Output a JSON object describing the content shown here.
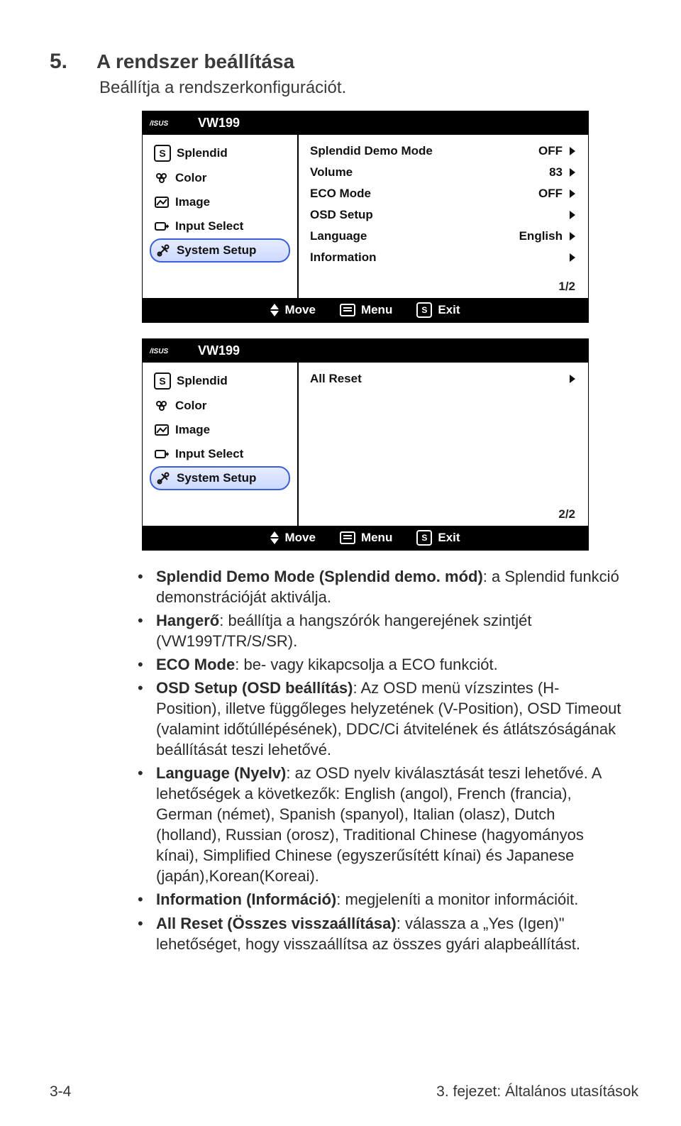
{
  "heading": {
    "number": "5.",
    "title": "A rendszer beállítása",
    "subtitle": "Beállítja a rendszerkonfigurációt."
  },
  "osd_top": {
    "model": "VW199",
    "menu_left": [
      {
        "icon": "S-box",
        "label": "Splendid",
        "selected": false
      },
      {
        "icon": "palette",
        "label": "Color",
        "selected": false
      },
      {
        "icon": "image",
        "label": "Image",
        "selected": false
      },
      {
        "icon": "input",
        "label": "Input Select",
        "selected": false
      },
      {
        "icon": "tools",
        "label": "System Setup",
        "selected": true
      }
    ],
    "menu_right": [
      {
        "label": "Splendid Demo Mode",
        "value": "OFF"
      },
      {
        "label": "Volume",
        "value": "83"
      },
      {
        "label": "ECO Mode",
        "value": "OFF"
      },
      {
        "label": "OSD Setup",
        "value": ""
      },
      {
        "label": "Language",
        "value": "English"
      },
      {
        "label": "Information",
        "value": ""
      }
    ],
    "page": "1/2",
    "footer": {
      "move": "Move",
      "menu": "Menu",
      "exit": "Exit"
    }
  },
  "osd_bottom": {
    "model": "VW199",
    "menu_left": [
      {
        "icon": "S-box",
        "label": "Splendid",
        "selected": false
      },
      {
        "icon": "palette",
        "label": "Color",
        "selected": false
      },
      {
        "icon": "image",
        "label": "Image",
        "selected": false
      },
      {
        "icon": "input",
        "label": "Input Select",
        "selected": false
      },
      {
        "icon": "tools",
        "label": "System Setup",
        "selected": true
      }
    ],
    "menu_right": [
      {
        "label": "All Reset",
        "value": ""
      }
    ],
    "page": "2/2",
    "footer": {
      "move": "Move",
      "menu": "Menu",
      "exit": "Exit"
    }
  },
  "bullets": [
    {
      "bold": "Splendid Demo Mode (Splendid demo. mód)",
      "text": ": a Splendid funkció demonstrációját aktiválja."
    },
    {
      "bold": "Hangerő",
      "text": ": beállítja a hangszórók hangerejének szintjét (VW199T/TR/S/SR)."
    },
    {
      "bold": "ECO Mode",
      "text": ": be- vagy kikapcsolja a ECO funkciót."
    },
    {
      "bold": "OSD Setup (OSD beállítás)",
      "text": ": Az OSD menü vízszintes (H-Position), illetve függőleges helyzetének (V-Position), OSD Timeout (valamint időtúllépésének), DDC/Ci átvitelének és átlátszóságának beállítását teszi lehetővé."
    },
    {
      "bold": "Language (Nyelv)",
      "text": ": az OSD nyelv kiválasztását teszi lehetővé. A lehetőségek a következők: English (angol), French (francia), German (német), Spanish (spanyol), Italian (olasz), Dutch (holland), Russian (orosz), Traditional Chinese (hagyományos kínai), Simplified Chinese (egyszerűsítétt kínai) és Japanese (japán),Korean(Koreai)."
    },
    {
      "bold": "Information (Információ)",
      "text": ": megjeleníti a monitor információit."
    },
    {
      "bold": "All Reset (Összes visszaállítása)",
      "text": ": válassza a „Yes (Igen)\" lehetőséget, hogy visszaállítsa az összes gyári alapbeállítást."
    }
  ],
  "footer": {
    "left": "3-4",
    "right": "3. fejezet: Általános utasítások"
  }
}
